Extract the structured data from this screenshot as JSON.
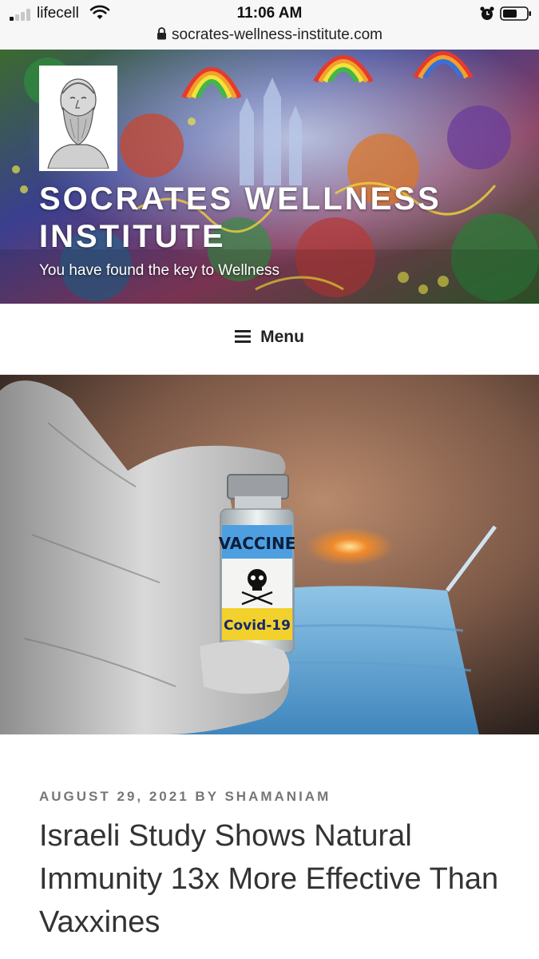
{
  "status_bar": {
    "carrier": "lifecell",
    "time": "11:06 AM",
    "url": "socrates-wellness-institute.com",
    "icons": [
      "signal-icon",
      "wifi-icon",
      "alarm-icon",
      "battery-icon",
      "lock-icon"
    ]
  },
  "site": {
    "title": "SOCRATES WELLNESS INSTITUTE",
    "tagline": "You have found the key to Wellness"
  },
  "nav": {
    "menu_label": "Menu",
    "menu_icon": "hamburger-icon"
  },
  "featured_image": {
    "vial_label_top": "VACCINE",
    "vial_label_bottom": "Covid-19"
  },
  "post": {
    "date": "AUGUST 29, 2021",
    "by": "BY",
    "author": "SHAMANIAM",
    "title": "Israeli Study Shows Natural Immunity 13x More Effective Than Vaxxines"
  },
  "colors": {
    "vial_blue": "#4d9fe0",
    "vial_yellow": "#f2d12c",
    "meta_gray": "#767676"
  }
}
